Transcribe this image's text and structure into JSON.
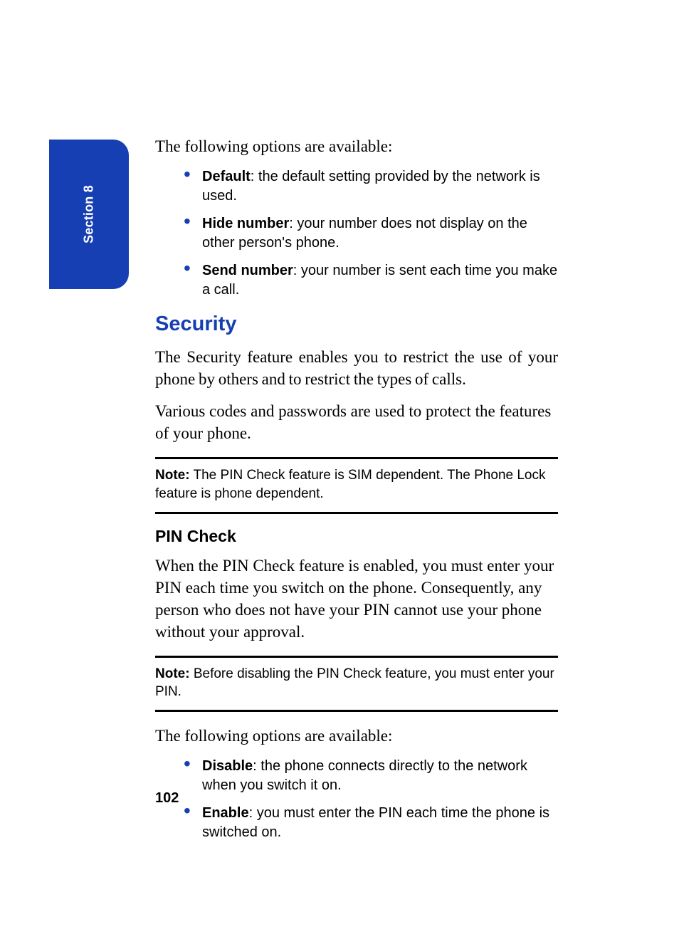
{
  "tab": {
    "label": "Section 8"
  },
  "intro1": "The following options are available:",
  "options1": [
    {
      "term": "Default",
      "desc": ": the default setting provided by the network is used."
    },
    {
      "term": "Hide number",
      "desc": ": your number does not display on the other person's phone."
    },
    {
      "term": "Send number",
      "desc": ": your number is sent each time you make a call."
    }
  ],
  "security": {
    "heading": "Security",
    "p1": "The Security feature enables you to restrict the use of your phone by others and to restrict the types of calls.",
    "p2": "Various codes and passwords are used to protect the features of your phone."
  },
  "note1": {
    "label": "Note:",
    "text": " The PIN Check feature is SIM dependent. The Phone Lock feature is phone dependent."
  },
  "pincheck": {
    "heading": "PIN Check",
    "p1": "When the PIN Check feature is enabled, you must enter your PIN each time you switch on the phone. Consequently, any person who does not have your PIN cannot use your phone without your approval."
  },
  "note2": {
    "label": "Note:",
    "text": " Before disabling the PIN Check feature, you must enter your PIN."
  },
  "intro2": "The following options are available:",
  "options2": [
    {
      "term": "Disable",
      "desc": ": the phone connects directly to the network when you switch it on."
    },
    {
      "term": "Enable",
      "desc": ": you must enter the PIN each time the phone is switched on."
    }
  ],
  "page_number": "102"
}
